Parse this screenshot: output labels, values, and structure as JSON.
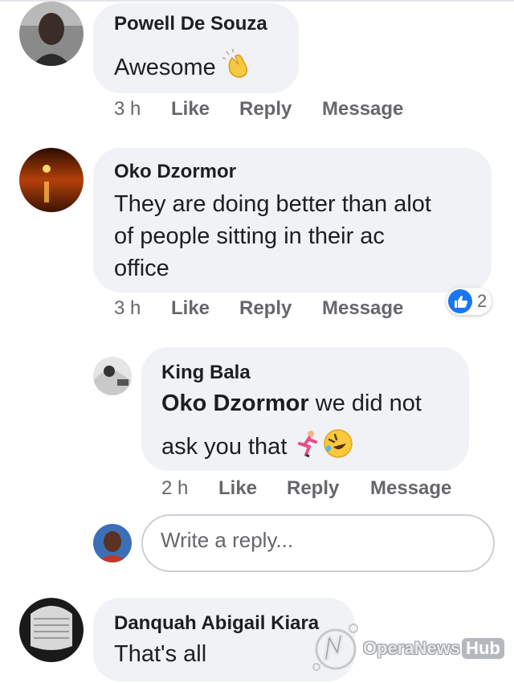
{
  "comments": [
    {
      "author": "Powell De Souza",
      "text": "Awesome",
      "emoji": "clapping-hands",
      "time": "3 h",
      "actions": {
        "like": "Like",
        "reply": "Reply",
        "message": "Message"
      }
    },
    {
      "author": "Oko Dzormor",
      "text_lines": [
        "They are doing better than alot",
        "of people sitting in their ac",
        "office"
      ],
      "time": "3 h",
      "actions": {
        "like": "Like",
        "reply": "Reply",
        "message": "Message"
      },
      "reaction": {
        "icon": "thumbs-up",
        "count": "2"
      },
      "replies": [
        {
          "author": "King Bala",
          "mention": "Oko Dzormor",
          "text_line1": " we did not",
          "text_line2": "ask you that",
          "emojis": [
            "runner",
            "rolling-laughing-face"
          ],
          "time": "2 h",
          "actions": {
            "like": "Like",
            "reply": "Reply",
            "message": "Message"
          }
        }
      ],
      "reply_box": {
        "placeholder": "Write a reply..."
      }
    },
    {
      "author": "Danquah Abigail Kiara",
      "text": "That's all"
    }
  ],
  "watermark": {
    "brand": "OperaNews",
    "hub": "Hub"
  },
  "colors": {
    "bubble": "#f0f2f5",
    "meta": "#65676b",
    "like_blue": "#1877f2"
  }
}
